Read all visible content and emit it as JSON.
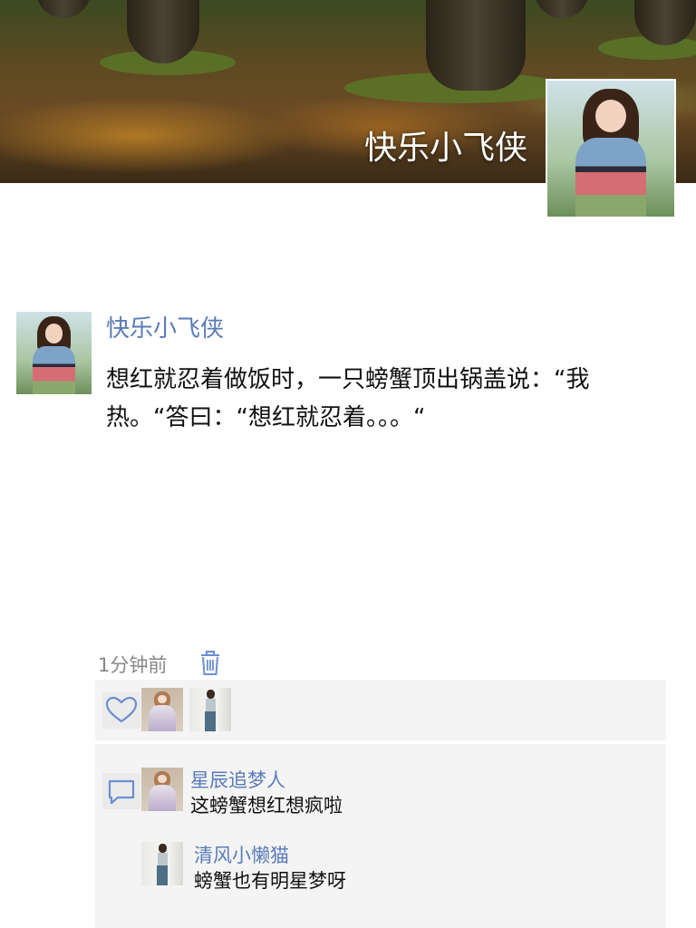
{
  "cover": {
    "name": "快乐小飞侠"
  },
  "post": {
    "author": "快乐小飞侠",
    "text": "想红就忍着做饭时，一只螃蟹顶出锅盖说：“我热。“答曰：“想红就忍着。。。“",
    "time": "1分钟前"
  },
  "likes": {
    "icon": "heart-icon",
    "avatars": [
      "liker-avatar-1",
      "liker-avatar-2"
    ]
  },
  "comments": [
    {
      "author": "星辰追梦人",
      "text": "这螃蟹想红想疯啦"
    },
    {
      "author": "清风小懒猫",
      "text": "螃蟹也有明星梦呀"
    }
  ],
  "colors": {
    "name_link": "#5a7bb8",
    "panel_bg": "#f4f4f4",
    "time_text": "#888888"
  }
}
